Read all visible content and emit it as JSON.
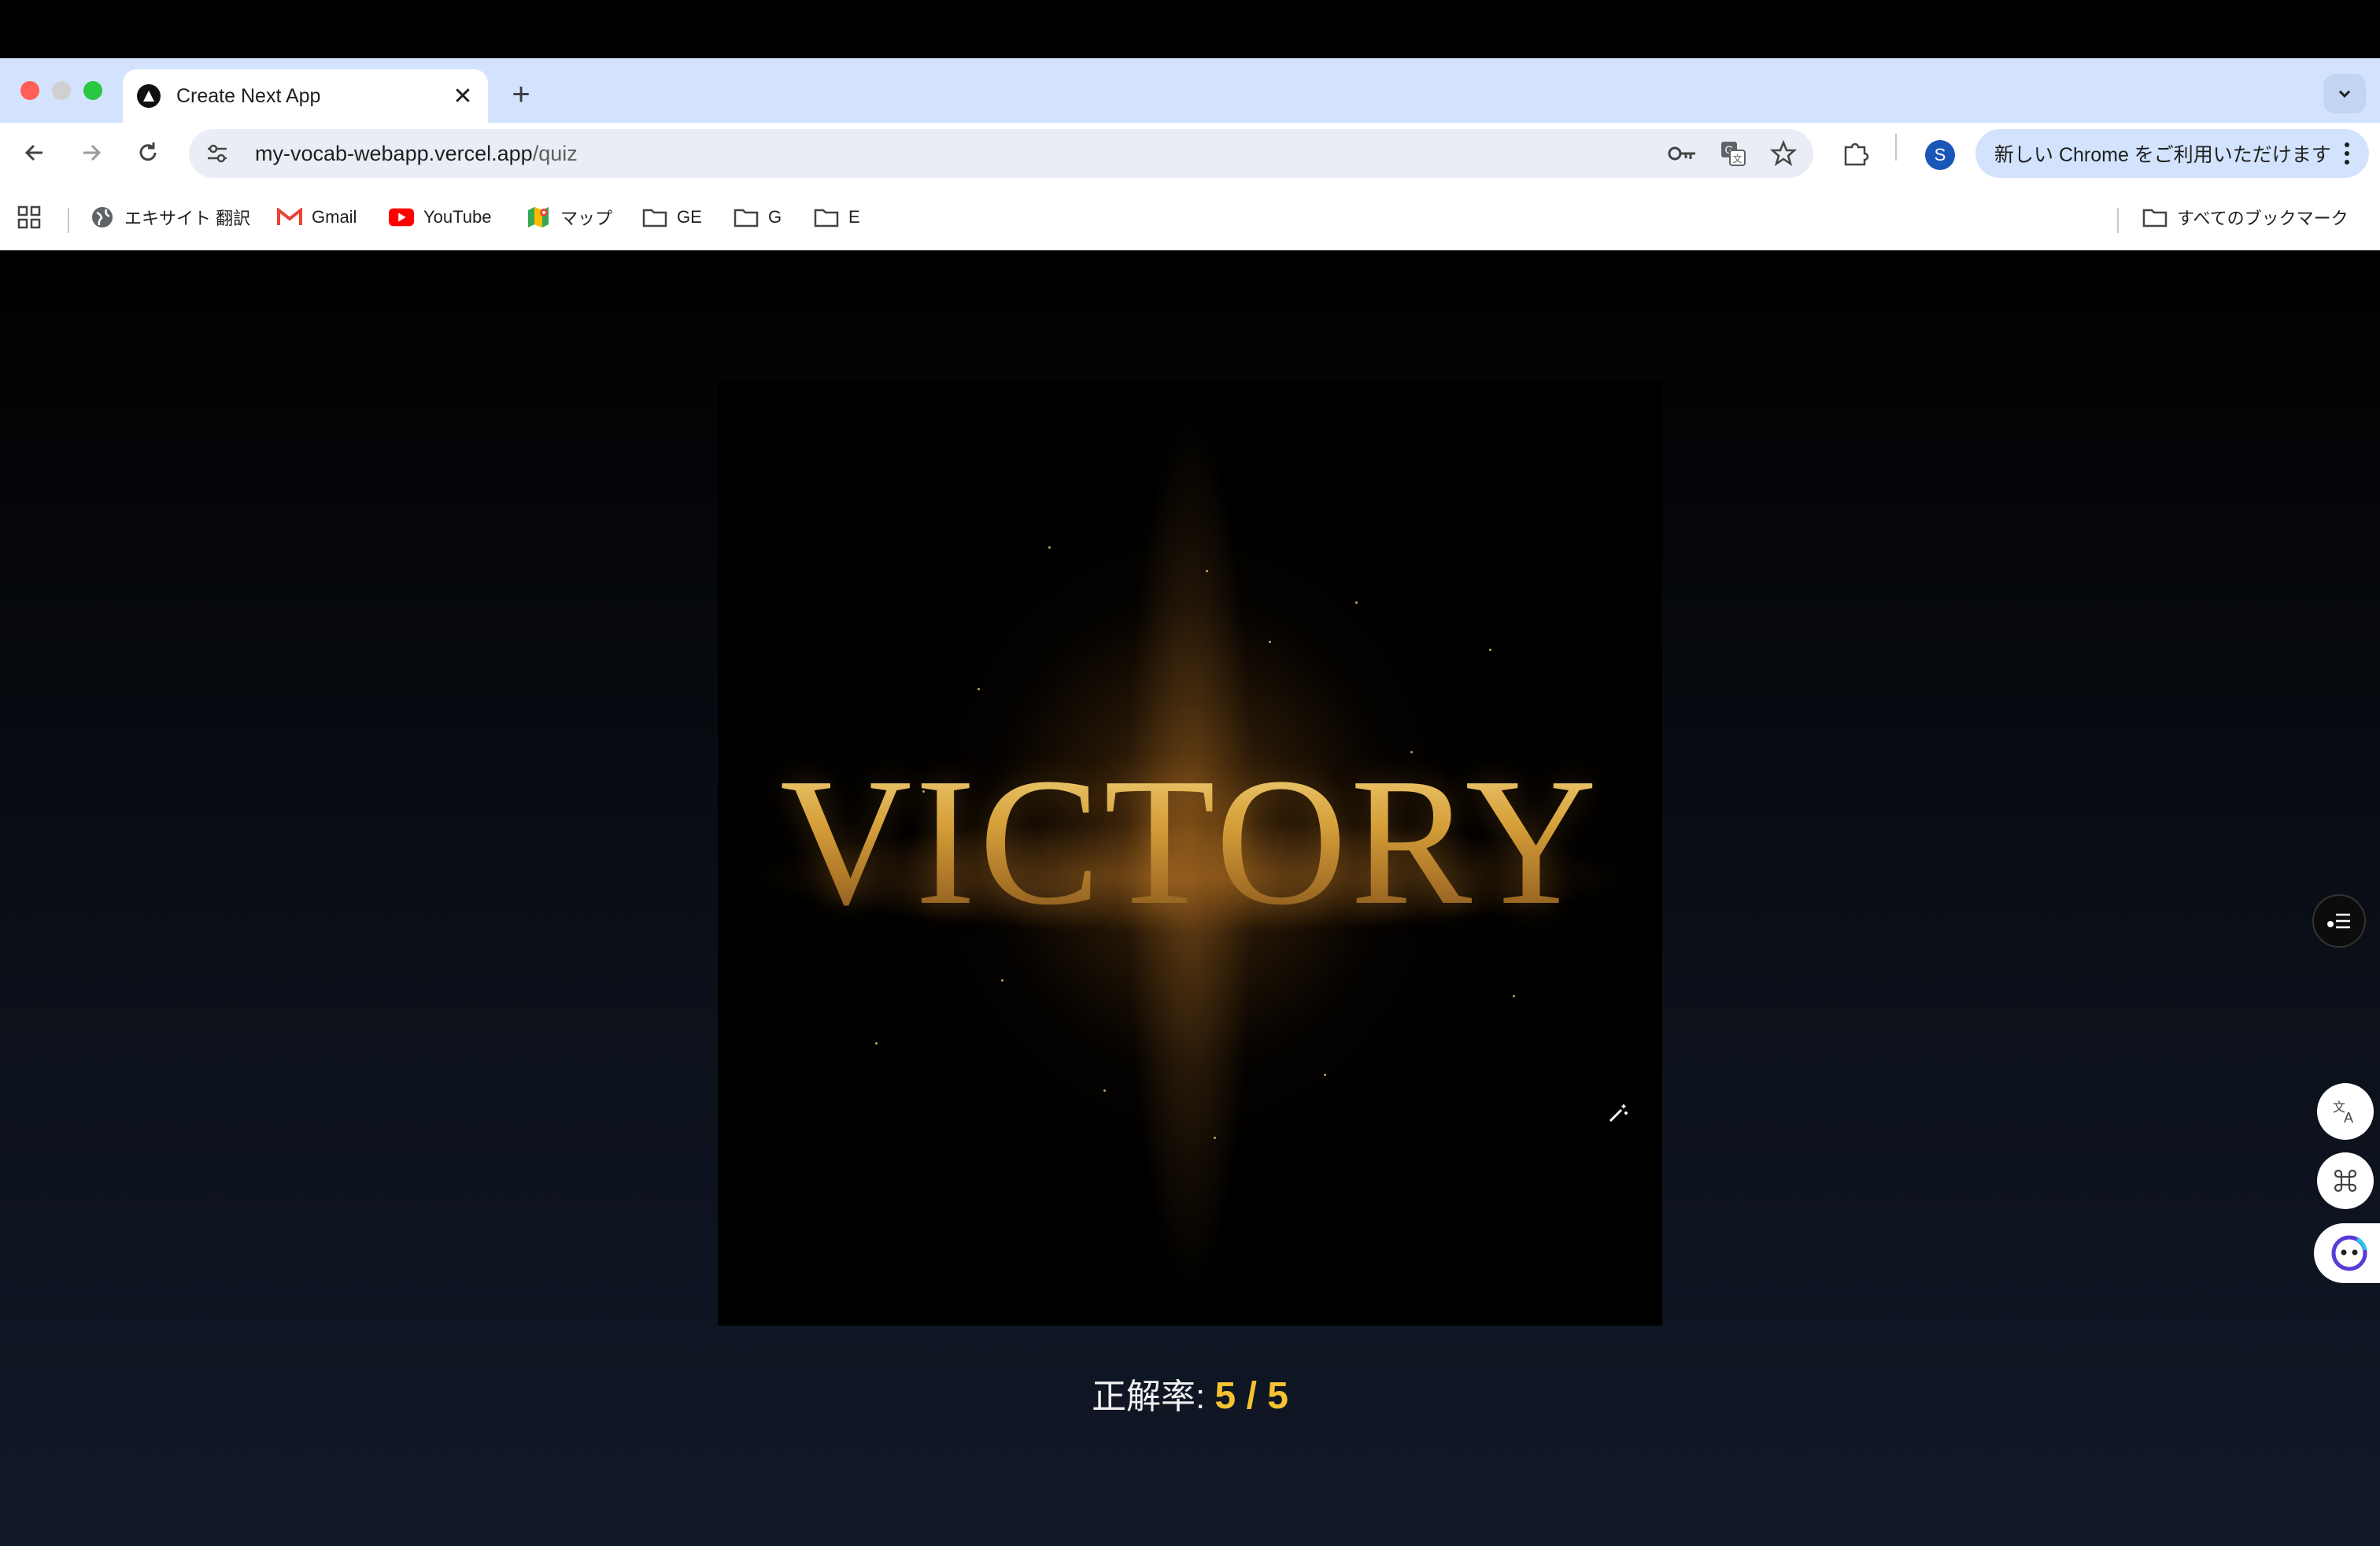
{
  "browser": {
    "tab": {
      "title": "Create Next App",
      "favicon": "nextjs-triangle-icon"
    },
    "url": {
      "host": "my-vocab-webapp.vercel.app",
      "path": "/quiz"
    },
    "profile_initial": "S",
    "promo_text": "新しい Chrome をご利用いただけます",
    "bookmarks": [
      {
        "label": "エキサイト 翻訳",
        "icon": "globe-icon"
      },
      {
        "label": "Gmail",
        "icon": "gmail-icon"
      },
      {
        "label": "YouTube",
        "icon": "youtube-icon"
      },
      {
        "label": "マップ",
        "icon": "maps-icon"
      },
      {
        "label": "GE",
        "icon": "folder-icon"
      },
      {
        "label": "G",
        "icon": "folder-icon"
      },
      {
        "label": "E",
        "icon": "folder-icon"
      }
    ],
    "all_bookmarks_label": "すべてのブックマーク"
  },
  "page": {
    "hero_image_text": "VICTORY",
    "score_label": "正解率:",
    "score_value": "5 / 5"
  },
  "colors": {
    "score_accent": "#f5c331",
    "tabstrip": "#d3e3fd",
    "omnibox": "#e9eef6",
    "avatar": "#1a56b8"
  }
}
